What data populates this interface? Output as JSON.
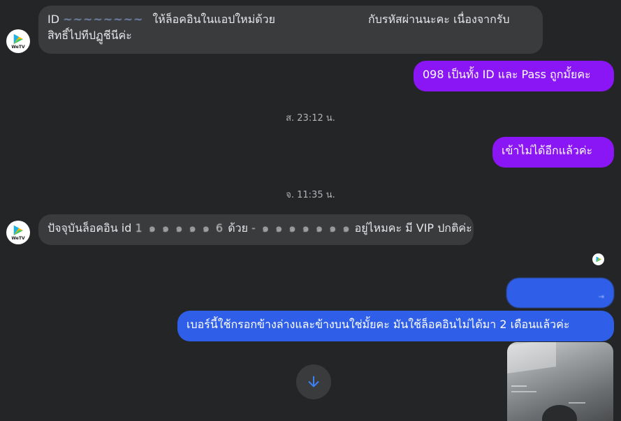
{
  "messages": {
    "m1": {
      "line1_prefix": "ID",
      "line1_redacted": "~~~~~~~~",
      "line1_mid": "ให้ล็อคอินในแอปใหม่ด้วย",
      "line1_end": "กับรหัสผ่านนะคะ เนื่องจากรับ",
      "line2": "สิทธิ์ไปทีปฏูชีนีค่ะ"
    },
    "m2": {
      "text": "098 เป็นทั้ง ID และ Pass ถูกมั้ยคะ"
    },
    "ts1": {
      "text": "ส. 23:12 น."
    },
    "m3": {
      "text": "เข้าไม่ได้อีกแล้วค่ะ"
    },
    "ts2": {
      "text": "จ. 11:35 น."
    },
    "m4": {
      "part1": "ปัจจุบันล็อคอิน id",
      "redacted1": "1 ๑ ๑ ๑ ๑ ๑ 6",
      "part2": "ด้วย",
      "redacted2": "- ๑ ๑ ๑ ๑ ๑ ๑ ๑",
      "part3": "อยู่ไหมคะ มี VIP ปกติค่ะ"
    },
    "m5": {
      "text": "→"
    },
    "m6": {
      "text": "เบอร์นี้ใช้กรอกข้างล่างและข้างบนใช่มั้ยคะ มันใช้ล็อคอินไม่ได้มา 2 เดือนแล้วค่ะ"
    }
  },
  "avatar": {
    "brand": "WeTV",
    "icon": "wetv-play-logo"
  },
  "scroll_button": {
    "icon": "arrow-down-icon"
  },
  "colors": {
    "background": "#242526",
    "incoming": "#3a3b3c",
    "outgoing_purple": "#8a15f5",
    "outgoing_blue": "#2f5fe8",
    "accent": "#3b82f6"
  }
}
